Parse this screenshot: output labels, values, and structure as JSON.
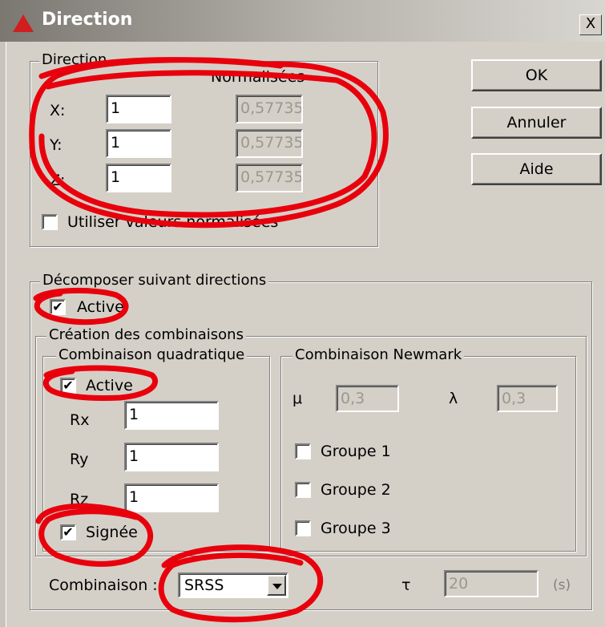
{
  "window": {
    "title": "Direction",
    "close_label": "X"
  },
  "buttons": {
    "ok": "OK",
    "cancel": "Annuler",
    "help": "Aide"
  },
  "direction_group": {
    "legend": "Direction",
    "normalized_header": "Normalisées",
    "rows": [
      {
        "label": "X:",
        "value": "1",
        "normalized": "0,57735"
      },
      {
        "label": "Y:",
        "value": "1",
        "normalized": "0,57735"
      },
      {
        "label": "Z:",
        "value": "1",
        "normalized": "0,57735"
      }
    ],
    "use_normalized": {
      "label": "Utiliser valeurs normalisées",
      "checked": false
    }
  },
  "decompose_group": {
    "legend": "Décomposer suivant directions",
    "active": {
      "label": "Active",
      "checked": true
    },
    "creation_group": {
      "legend": "Création des combinaisons",
      "quadratic": {
        "legend": "Combinaison quadratique",
        "active": {
          "label": "Active",
          "checked": true
        },
        "rows": [
          {
            "label": "Rx",
            "value": "1"
          },
          {
            "label": "Ry",
            "value": "1"
          },
          {
            "label": "Rz",
            "value": "1"
          }
        ],
        "signed": {
          "label": "Signée",
          "checked": true
        }
      },
      "newmark": {
        "legend": "Combinaison Newmark",
        "mu_label": "μ",
        "mu_value": "0,3",
        "lambda_label": "λ",
        "lambda_value": "0,3",
        "groups": [
          {
            "label": "Groupe 1",
            "checked": false
          },
          {
            "label": "Groupe 2",
            "checked": false
          },
          {
            "label": "Groupe 3",
            "checked": false
          }
        ]
      }
    },
    "combination": {
      "label": "Combinaison :",
      "selected": "SRSS"
    },
    "tau": {
      "label": "τ",
      "value": "20",
      "unit": "(s)"
    }
  },
  "annotation_color": "#e8000c"
}
